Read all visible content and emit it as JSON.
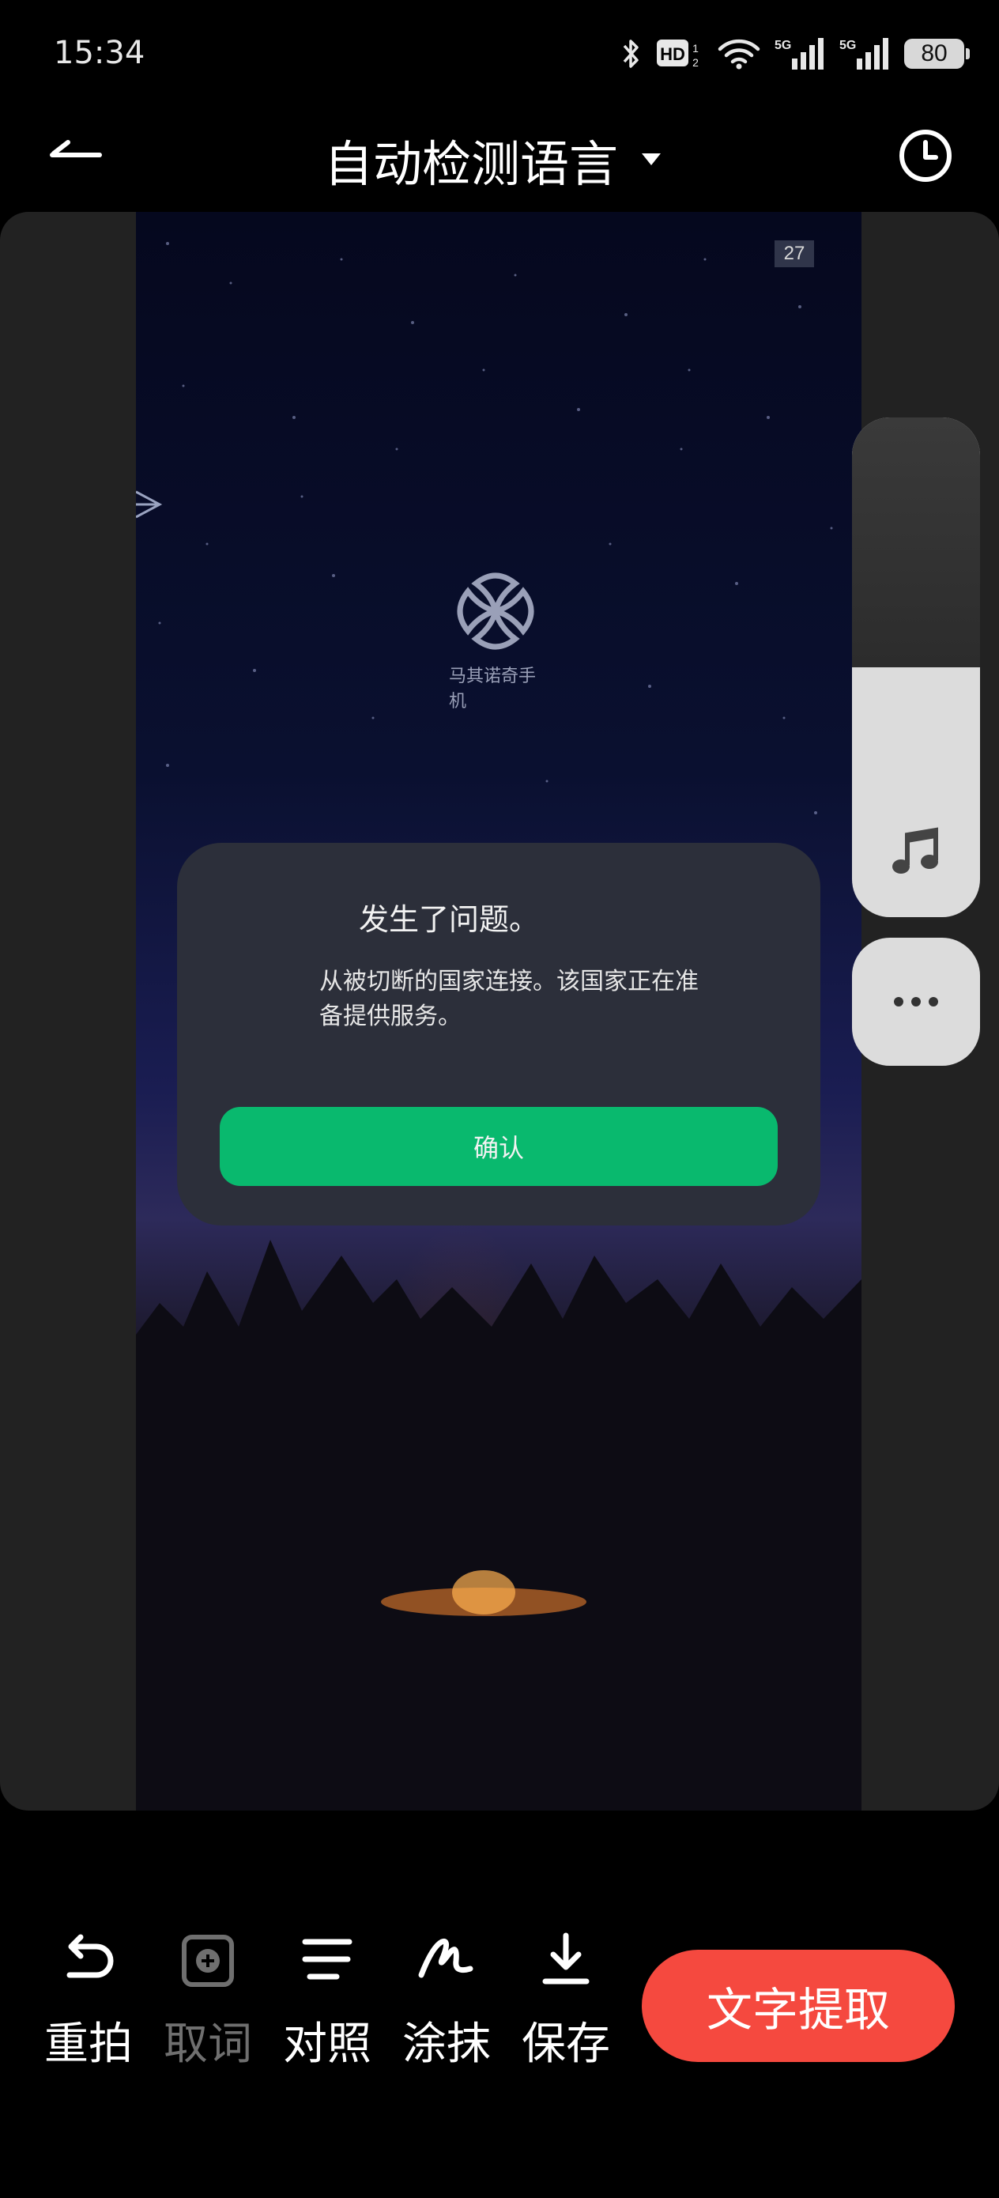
{
  "status_bar": {
    "time": "15:34",
    "hd_label": "HD",
    "hd_sub": "1 2",
    "signal1_label": "5G",
    "signal2_label": "5G",
    "battery": "80"
  },
  "header": {
    "language_label": "自动检测语言",
    "back_icon": "back-arrow-icon",
    "dropdown_icon": "caret-down-icon",
    "history_icon": "clock-icon"
  },
  "preview": {
    "page_counter": "27",
    "logo_text": "马其诺奇手机",
    "dialog": {
      "title": "发生了问题。",
      "message": "从被切断的国家连接。该国家正在准备提供服务。",
      "confirm_label": "确认",
      "confirm_color": "#09b96e"
    }
  },
  "side_panel": {
    "music_icon": "music-note-icon",
    "more_icon": "more-dots-icon"
  },
  "toolbar": {
    "retake_label": "重拍",
    "pick_word_label": "取词",
    "compare_label": "对照",
    "erase_label": "涂抹",
    "save_label": "保存",
    "extract_label": "文字提取",
    "extract_color": "#f5493f"
  }
}
